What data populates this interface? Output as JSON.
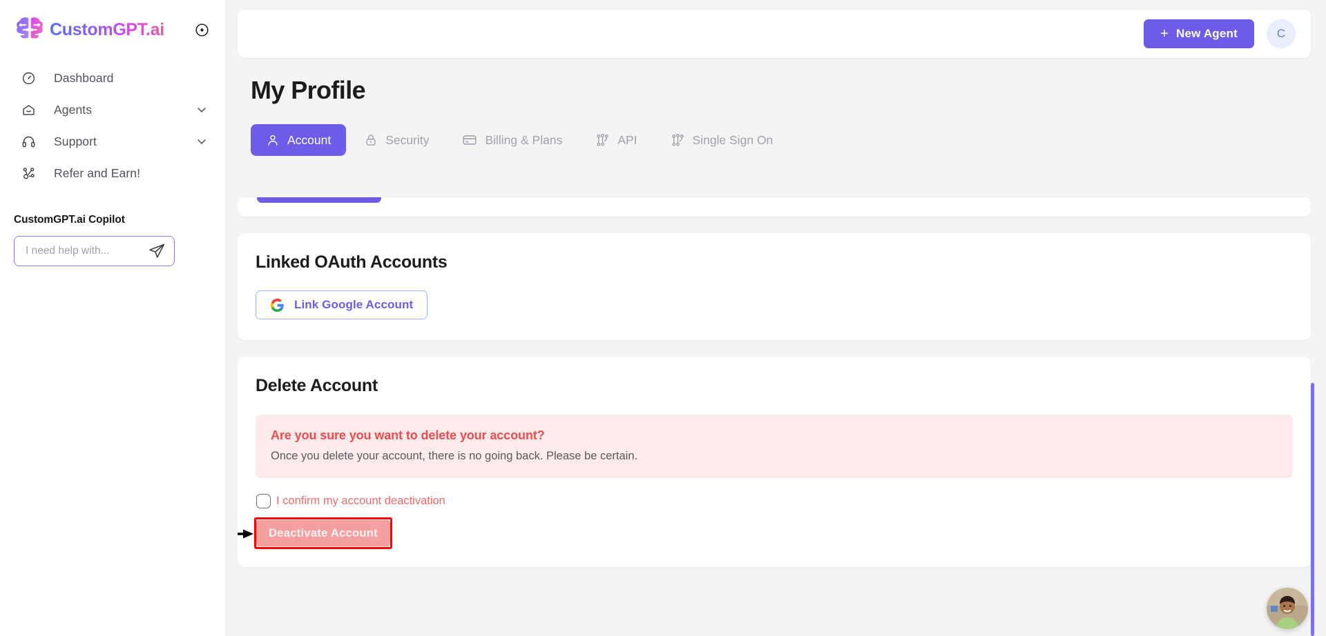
{
  "brand": {
    "name": "CustomGPT.ai",
    "collapse_icon": "circle-dot-icon"
  },
  "sidebar": {
    "items": [
      {
        "label": "Dashboard",
        "icon": "dashboard-icon",
        "has_chevron": false
      },
      {
        "label": "Agents",
        "icon": "agents-home-icon",
        "has_chevron": true
      },
      {
        "label": "Support",
        "icon": "headset-icon",
        "has_chevron": true
      },
      {
        "label": "Refer and Earn!",
        "icon": "share-nodes-icon",
        "has_chevron": false
      }
    ],
    "copilot": {
      "title": "CustomGPT.ai Copilot",
      "placeholder": "I need help with...",
      "value": "",
      "send_icon": "send-plane-icon"
    }
  },
  "topbar": {
    "new_agent_label": "New Agent",
    "new_agent_icon": "plus-icon",
    "avatar_initial": "C"
  },
  "page": {
    "title": "My Profile"
  },
  "tabs": [
    {
      "label": "Account",
      "icon": "user-icon",
      "active": true
    },
    {
      "label": "Security",
      "icon": "lock-icon",
      "active": false
    },
    {
      "label": "Billing & Plans",
      "icon": "credit-card-icon",
      "active": false
    },
    {
      "label": "API",
      "icon": "nodes-icon",
      "active": false
    },
    {
      "label": "Single Sign On",
      "icon": "nodes-icon",
      "active": false
    }
  ],
  "oauth": {
    "title": "Linked OAuth Accounts",
    "link_google_label": "Link Google Account",
    "google_icon": "google-g-icon"
  },
  "delete_account": {
    "title": "Delete Account",
    "warning_title": "Are you sure you want to delete your account?",
    "warning_body": "Once you delete your account, there is no going back. Please be certain.",
    "confirm_label": "I confirm my account deactivation",
    "confirm_checked": false,
    "deactivate_label": "Deactivate Account"
  },
  "annotation": {
    "arrow": "black-arrow-pointing-right",
    "highlight_color": "#ff0000"
  },
  "colors": {
    "accent": "#6c5ce7",
    "danger": "#ef4d4d",
    "danger_bg": "#fdeaea",
    "page_bg": "#f4f4f5",
    "scrollbar": "#7c6ef0"
  }
}
